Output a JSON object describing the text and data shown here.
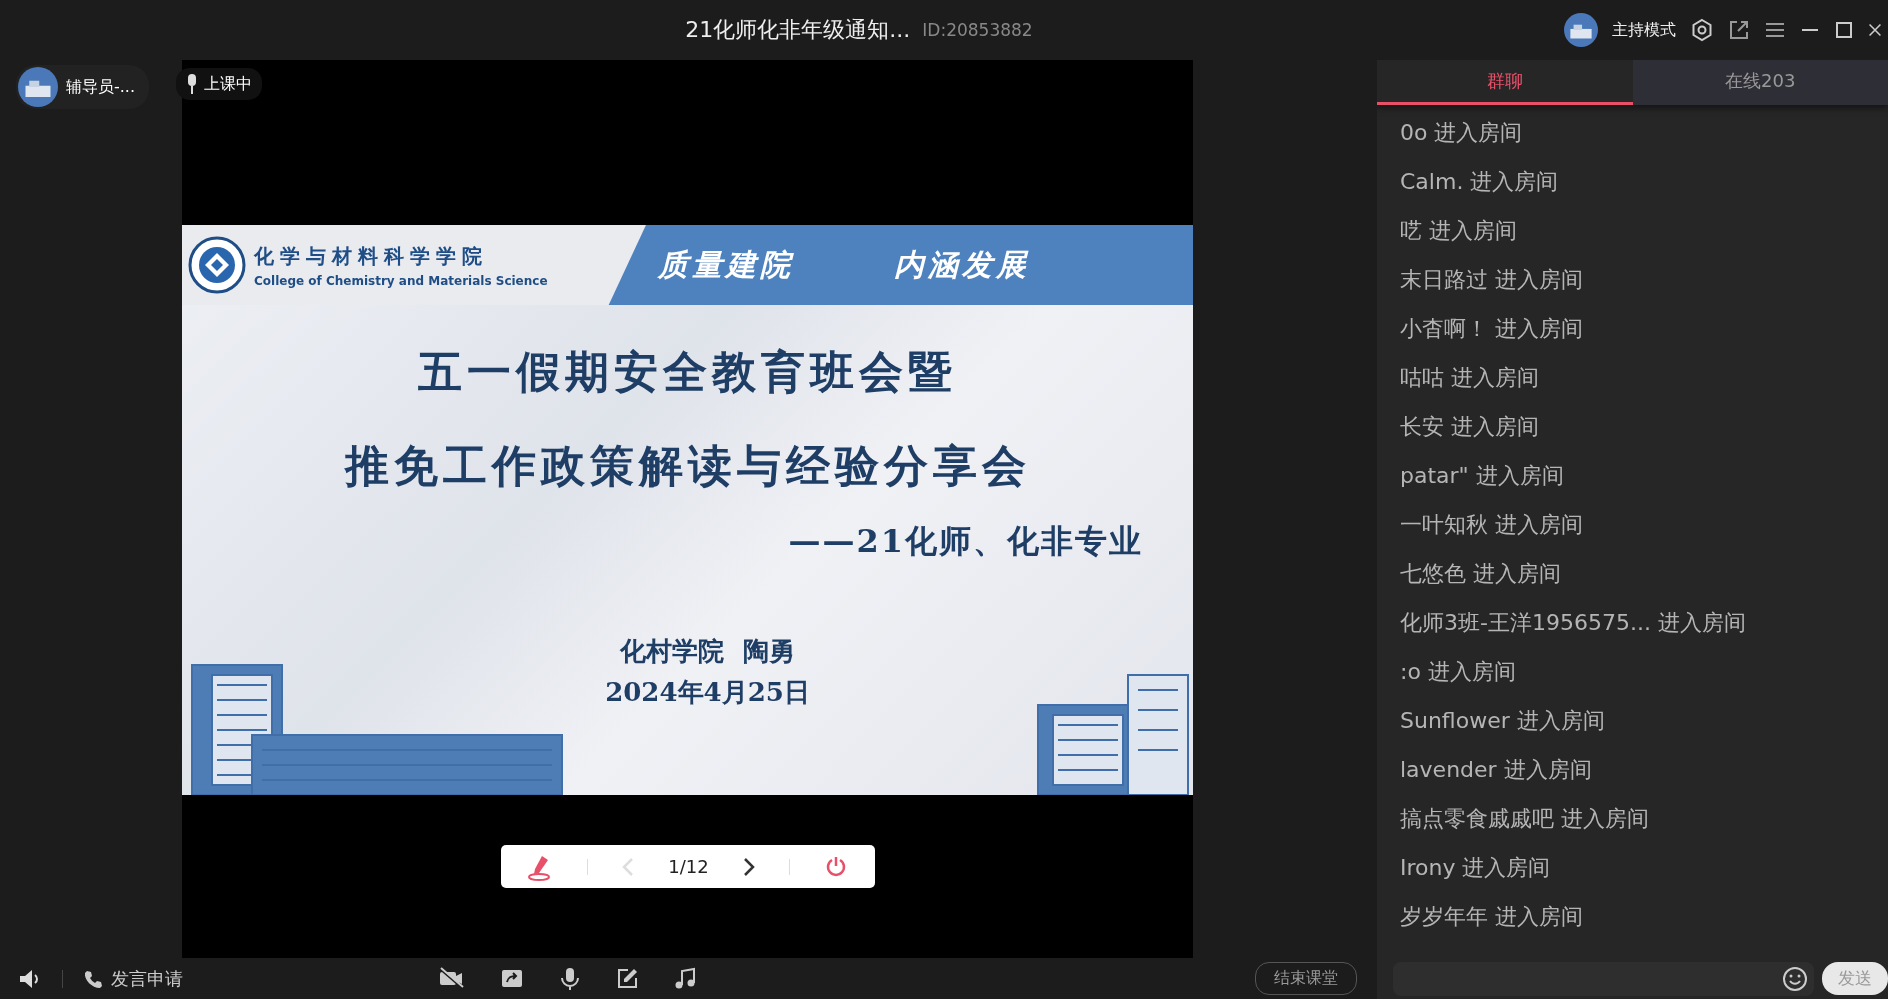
{
  "window": {
    "title": "21化师化非年级通知...",
    "room_id": "ID:20853882",
    "mode_label": "主持模式"
  },
  "presenter": {
    "name": "辅导员-..."
  },
  "status": {
    "label": "上课中"
  },
  "slide": {
    "college_name_zh": "化学与材料科学学院",
    "college_name_en": "College of Chemistry and Materials Science",
    "mottos": [
      "质量建院",
      "内涵发展"
    ],
    "title_lines": [
      "五一假期安全教育班会暨",
      "推免工作政策解读与经验分享会"
    ],
    "subtitle": "——21化师、化非专业",
    "author": "化村学院  陶勇",
    "date": "2024年4月25日"
  },
  "slide_controls": {
    "page": "1/12",
    "prev_disabled": true
  },
  "chat": {
    "tabs": [
      {
        "label": "群聊",
        "selected": true
      },
      {
        "label": "在线203",
        "selected": false
      }
    ],
    "messages": [
      {
        "text": "0o 进入房间"
      },
      {
        "text": "Calm. 进入房间"
      },
      {
        "text": "呓 进入房间"
      },
      {
        "text": "末日路过 进入房间"
      },
      {
        "text": "小杳啊！ 进入房间"
      },
      {
        "text": "咕咕 进入房间"
      },
      {
        "text": "长安 进入房间"
      },
      {
        "text": "patar\" 进入房间"
      },
      {
        "text": "一叶知秋 进入房间"
      },
      {
        "text": "七悠色 进入房间"
      },
      {
        "text": "化师3班-王洋1956575... 进入房间"
      },
      {
        "text": ":o 进入房间"
      },
      {
        "text": "Sunflower 进入房间"
      },
      {
        "text": "lavender 进入房间"
      },
      {
        "text": "搞点零食戚戚吧 进入房间"
      },
      {
        "text": "Irony 进入房间"
      },
      {
        "text": "岁岁年年 进入房间"
      }
    ]
  },
  "bottom_bar": {
    "raise_hand": "发言申请",
    "end_class": "结束课堂",
    "send": "发送"
  }
}
